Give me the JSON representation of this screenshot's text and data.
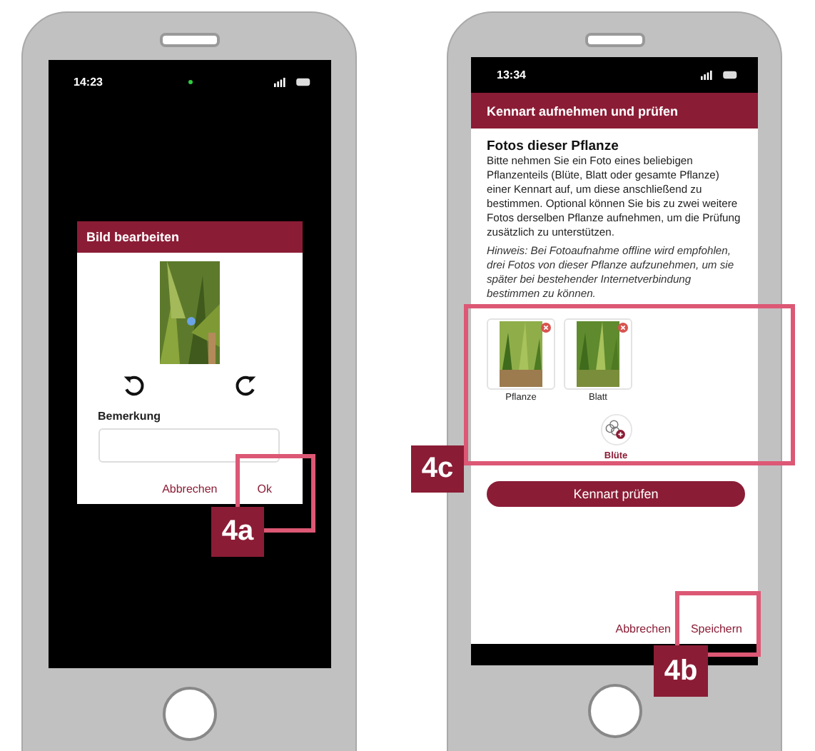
{
  "left_phone": {
    "status_bar": {
      "time": "14:23"
    },
    "dialog": {
      "title": "Bild bearbeiten",
      "field_label": "Bemerkung",
      "buttons": [
        "Abbrechen",
        "Ok"
      ]
    },
    "callout": {
      "label": "4a"
    }
  },
  "right_phone": {
    "status_bar": {
      "time": "13:34"
    },
    "header": {
      "title": "Kennart aufnehmen und prüfen"
    },
    "section": {
      "title": "Fotos dieser Pflanze",
      "text": "Bitte nehmen Sie ein Foto eines beliebigen Pflanzenteils (Blüte, Blatt oder gesamte Pflanze) einer Kennart auf, um diese anschließend zu bestimmen. Optional können Sie bis zu zwei weitere Fotos derselben Pflanze aufnehmen, um die Prüfung zusätzlich zu unterstützen.",
      "hint": "Hinweis: Bei Fotoaufnahme offline wird empfohlen, drei Fotos von dieser Pflanze aufzunehmen, um sie später bei bestehender Internetverbindung bestimmen zu können."
    },
    "photos": [
      {
        "label": "Pflanze"
      },
      {
        "label": "Blatt"
      }
    ],
    "add_photo": {
      "label": "Blüte"
    },
    "check_button": "Kennart prüfen",
    "footer_buttons": [
      "Abbrechen",
      "Speichern"
    ],
    "callouts": [
      {
        "label": "4c"
      },
      {
        "label": "4b"
      }
    ]
  }
}
